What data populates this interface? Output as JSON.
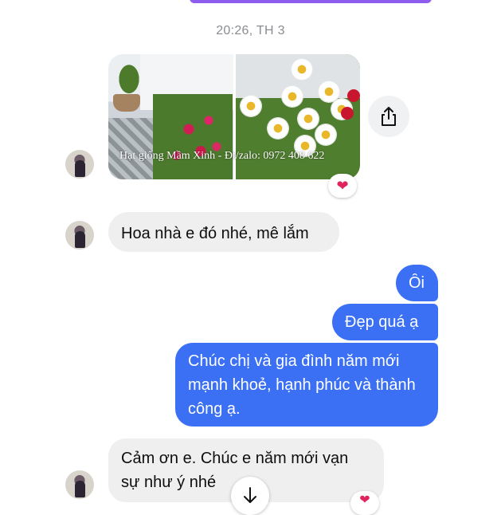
{
  "chat": {
    "timestamp": "20:26, TH 3",
    "image_watermark": "Hạt giống Mầm Xinh - Đt/zalo: 0972 408 622",
    "reaction_icon": "heart",
    "messages": [
      {
        "side": "incoming",
        "text": "Hoa nhà e đó nhé, mê lắm"
      },
      {
        "side": "outgoing",
        "text": "Ôi"
      },
      {
        "side": "outgoing",
        "text": "Đẹp quá ạ"
      },
      {
        "side": "outgoing",
        "text": "Chúc chị và gia đình năm mới mạnh khoẻ, hạnh phúc và thành công ạ."
      },
      {
        "side": "incoming",
        "text": "Cảm ơn e. Chúc e năm mới vạn sự như ý nhé"
      }
    ]
  },
  "icons": {
    "share": "share-icon",
    "scroll_down": "arrow-down-icon",
    "reaction": "heart-icon"
  },
  "colors": {
    "outgoing_bubble": "#3b6ff4",
    "incoming_bubble": "#efefef",
    "timestamp_text": "#8a8d91",
    "heart": "#e0245e"
  }
}
